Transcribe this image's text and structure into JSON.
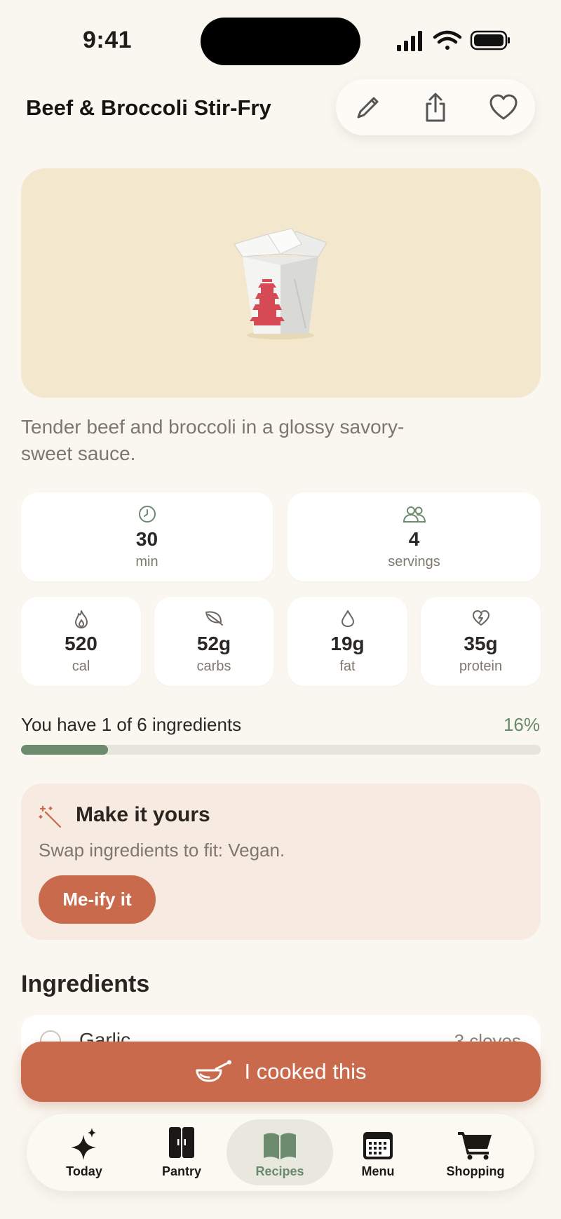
{
  "status": {
    "time": "9:41"
  },
  "header": {
    "title": "Beef & Broccoli Stir-Fry"
  },
  "actions": [
    {
      "name": "edit",
      "icon": "pencil-icon"
    },
    {
      "name": "share",
      "icon": "share-icon"
    },
    {
      "name": "favorite",
      "icon": "heart-icon"
    }
  ],
  "hero": {
    "icon": "takeout-box-icon"
  },
  "description": "Tender beef and broccoli in a glossy savory-sweet sauce.",
  "stats": {
    "time": {
      "value": "30",
      "label": "min",
      "icon": "clock-icon"
    },
    "servings": {
      "value": "4",
      "label": "servings",
      "icon": "people-icon"
    }
  },
  "nutrition": {
    "calories": {
      "value": "520",
      "label": "cal",
      "icon": "flame-icon"
    },
    "carbs": {
      "value": "52g",
      "label": "carbs",
      "icon": "leaf-icon"
    },
    "fat": {
      "value": "19g",
      "label": "fat",
      "icon": "drop-icon"
    },
    "protein": {
      "value": "35g",
      "label": "protein",
      "icon": "heart-bolt-icon"
    }
  },
  "progress": {
    "label": "You have 1 of 6 ingredients",
    "percent_text": "16%",
    "fraction": 0.1667
  },
  "make_it_yours": {
    "title": "Make it yours",
    "subtitle": "Swap ingredients to fit: Vegan.",
    "button": "Me-ify it",
    "icon": "magic-wand-icon"
  },
  "ingredients": {
    "title": "Ingredients",
    "items": [
      {
        "name": "Garlic",
        "qty": "3 cloves"
      }
    ]
  },
  "cooked_button": {
    "label": "I cooked this",
    "icon": "bowl-icon"
  },
  "tabs": [
    {
      "label": "Today",
      "icon": "sparkle-icon"
    },
    {
      "label": "Pantry",
      "icon": "cabinet-icon"
    },
    {
      "label": "Recipes",
      "icon": "book-icon",
      "active": true
    },
    {
      "label": "Menu",
      "icon": "calendar-icon"
    },
    {
      "label": "Shopping",
      "icon": "cart-icon"
    }
  ],
  "colors": {
    "background": "#FAF7F0",
    "accent": "#C96A4C",
    "green": "#6B8A6E",
    "hero_bg": "#F3E7CD",
    "card_pink": "#F7EAE1"
  }
}
